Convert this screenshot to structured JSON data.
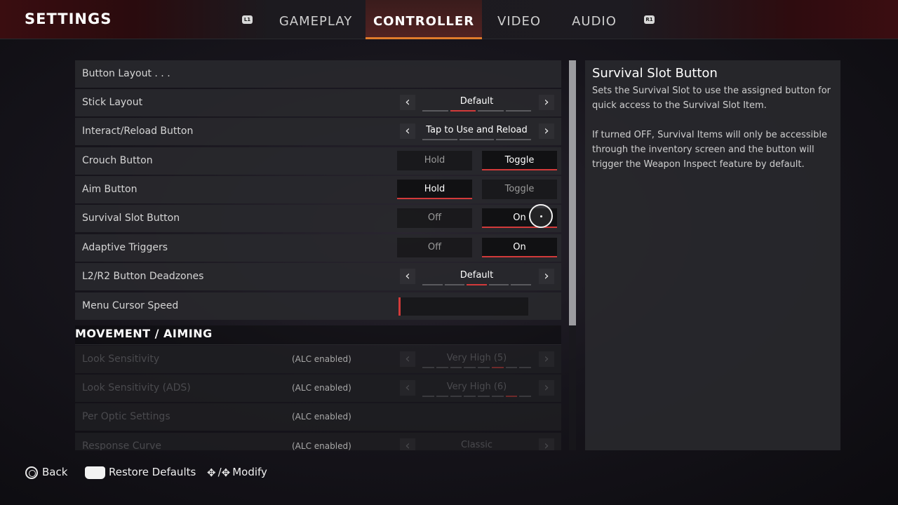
{
  "header": {
    "title": "SETTINGS",
    "left_bumper": "L1",
    "right_bumper": "R1",
    "tabs": [
      {
        "label": "GAMEPLAY"
      },
      {
        "label": "CONTROLLER"
      },
      {
        "label": "VIDEO"
      },
      {
        "label": "AUDIO"
      }
    ],
    "active_tab": "CONTROLLER"
  },
  "rows": [
    {
      "label": "Button Layout . . ."
    },
    {
      "label": "Stick Layout",
      "value": "Default",
      "ticks": 4,
      "selected_index": 1
    },
    {
      "label": "Interact/Reload Button",
      "value": "Tap to Use and Reload",
      "ticks": 3,
      "selected_index": 3
    },
    {
      "label": "Crouch Button",
      "options": [
        "Hold",
        "Toggle"
      ],
      "selected": "Toggle"
    },
    {
      "label": "Aim Button",
      "options": [
        "Hold",
        "Toggle"
      ],
      "selected": "Hold"
    },
    {
      "label": "Survival Slot Button",
      "options": [
        "Off",
        "On"
      ],
      "selected": "On"
    },
    {
      "label": "Adaptive Triggers",
      "options": [
        "Off",
        "On"
      ],
      "selected": "On"
    },
    {
      "label": "L2/R2 Button Deadzones",
      "value": "Default",
      "ticks": 5,
      "selected_index": 2
    },
    {
      "label": "Menu Cursor Speed",
      "level": 0.0
    }
  ],
  "section": {
    "title": "MOVEMENT / AIMING"
  },
  "disabled_rows": [
    {
      "label": "Look Sensitivity",
      "note": "(ALC enabled)",
      "value": "Very High (5)",
      "ticks": 8,
      "selected_index": 5
    },
    {
      "label": "Look Sensitivity (ADS)",
      "note": "(ALC enabled)",
      "value": "Very High (6)",
      "ticks": 8,
      "selected_index": 6
    },
    {
      "label": "Per Optic Settings",
      "note": "(ALC enabled)"
    },
    {
      "label": "Response Curve",
      "note": "(ALC enabled)",
      "value": "Classic"
    }
  ],
  "description": {
    "title": "Survival Slot Button",
    "paragraph1": "Sets the Survival Slot to use the assigned button for quick access to the Survival Slot Item.",
    "paragraph2": "If turned OFF, Survival Items will only be accessible through the inventory screen and the button will trigger the Weapon Inspect feature by default."
  },
  "footer": {
    "back_label": "Back",
    "restore_label": "Restore Defaults",
    "modify_label": "Modify",
    "modify_separator": "/"
  },
  "scroll_fraction_visible": 0.68,
  "colors": {
    "accent_red": "#d23a3a",
    "tab_underline": "#e07b2b"
  }
}
